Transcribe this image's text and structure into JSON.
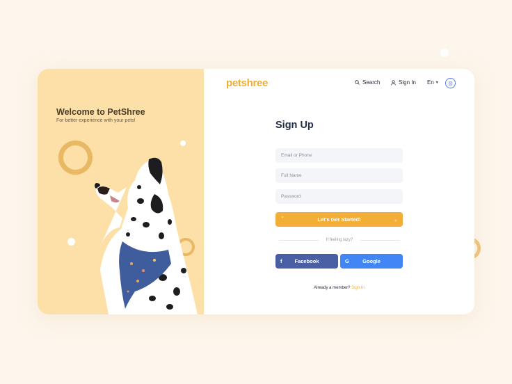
{
  "colors": {
    "page_bg": "#fdf6ec",
    "left_panel_bg": "#fde0a8",
    "accent": "#f3ae38",
    "facebook": "#4a5fa3",
    "google": "#4285f4",
    "heading": "#1f2d45"
  },
  "welcome": {
    "title": "Welcome to PetShree",
    "subtitle": "For better experience with your pets!"
  },
  "header": {
    "logo": "petshree",
    "search_label": "Search",
    "search_icon": "search-icon",
    "signin_label": "Sign In",
    "signin_icon": "user-icon",
    "language": "En",
    "language_icon": "chevron-down-icon",
    "menu_icon": "menu-icon"
  },
  "form": {
    "title": "Sign Up",
    "email_placeholder": "Email or Phone",
    "name_placeholder": "Full Name",
    "password_placeholder": "Password",
    "submit_label": "Let's Get Started!",
    "divider_text": "If feeling lazy?",
    "facebook_label": "Facebook",
    "facebook_icon_glyph": "f",
    "google_label": "Google",
    "google_icon_glyph": "G",
    "member_text": "Already a member?",
    "member_link": "Sign In"
  }
}
